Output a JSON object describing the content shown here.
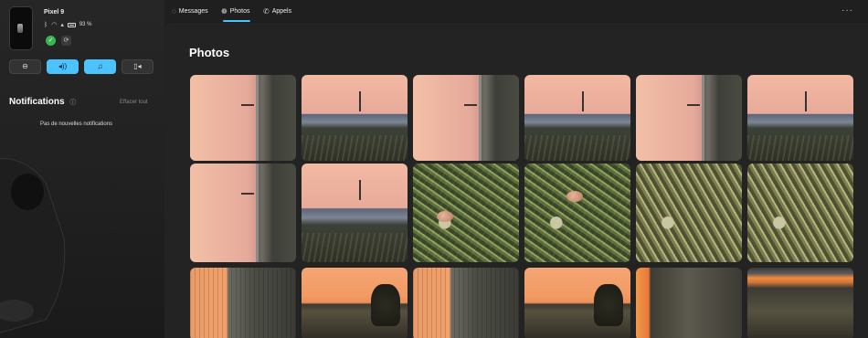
{
  "sidebar": {
    "device_name": "Pixel 9",
    "battery": "93 %",
    "quick_actions": [
      {
        "icon": "minus-circle-icon",
        "glyph": "⊖",
        "active": false
      },
      {
        "icon": "volume-icon",
        "glyph": "🔊",
        "active": true
      },
      {
        "icon": "music-icon",
        "glyph": "♫",
        "active": true
      },
      {
        "icon": "cast-icon",
        "glyph": "▣",
        "active": false
      }
    ],
    "notifications_title": "Notifications",
    "clear_all": "Effacer tout",
    "no_notifications": "Pas de nouvelles notifications"
  },
  "tabs": [
    {
      "label": "Messages",
      "icon": "chat-icon",
      "glyph": "💬"
    },
    {
      "label": "Photos",
      "icon": "photos-icon",
      "glyph": "⚙"
    },
    {
      "label": "Appels",
      "icon": "phone-icon",
      "glyph": "✆"
    }
  ],
  "active_tab": "Photos",
  "more_glyph": "···",
  "main": {
    "title": "Photos"
  },
  "colors": {
    "accent": "#4cc2ff",
    "success": "#36b84e",
    "background": "#1c1c1c"
  }
}
